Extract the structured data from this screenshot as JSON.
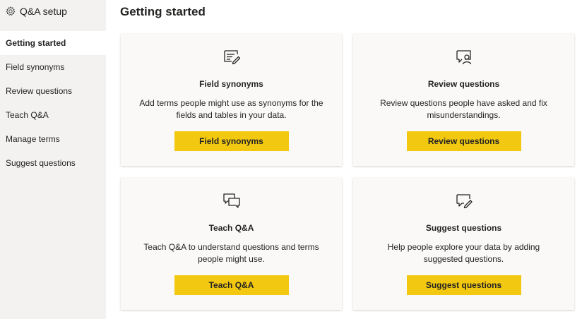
{
  "sidebar": {
    "title": "Q&A setup",
    "items": [
      {
        "label": "Getting started"
      },
      {
        "label": "Field synonyms"
      },
      {
        "label": "Review questions"
      },
      {
        "label": "Teach Q&A"
      },
      {
        "label": "Manage terms"
      },
      {
        "label": "Suggest questions"
      }
    ],
    "active_index": 0
  },
  "main": {
    "title": "Getting started",
    "cards": [
      {
        "icon": "pencil-note-icon",
        "title": "Field synonyms",
        "description": "Add terms people might use as synonyms for the fields and tables in your data.",
        "button": "Field synonyms"
      },
      {
        "icon": "person-chat-icon",
        "title": "Review questions",
        "description": "Review questions people have asked and fix misunderstandings.",
        "button": "Review questions"
      },
      {
        "icon": "conversation-icon",
        "title": "Teach Q&A",
        "description": "Teach Q&A to understand questions and terms people might use.",
        "button": "Teach Q&A"
      },
      {
        "icon": "chat-pencil-icon",
        "title": "Suggest questions",
        "description": "Help people explore your data by adding suggested questions.",
        "button": "Suggest questions"
      }
    ]
  },
  "colors": {
    "accent": "#f2c811",
    "sidebar_bg": "#f3f2f1",
    "card_bg": "#faf9f8",
    "text": "#252423"
  }
}
